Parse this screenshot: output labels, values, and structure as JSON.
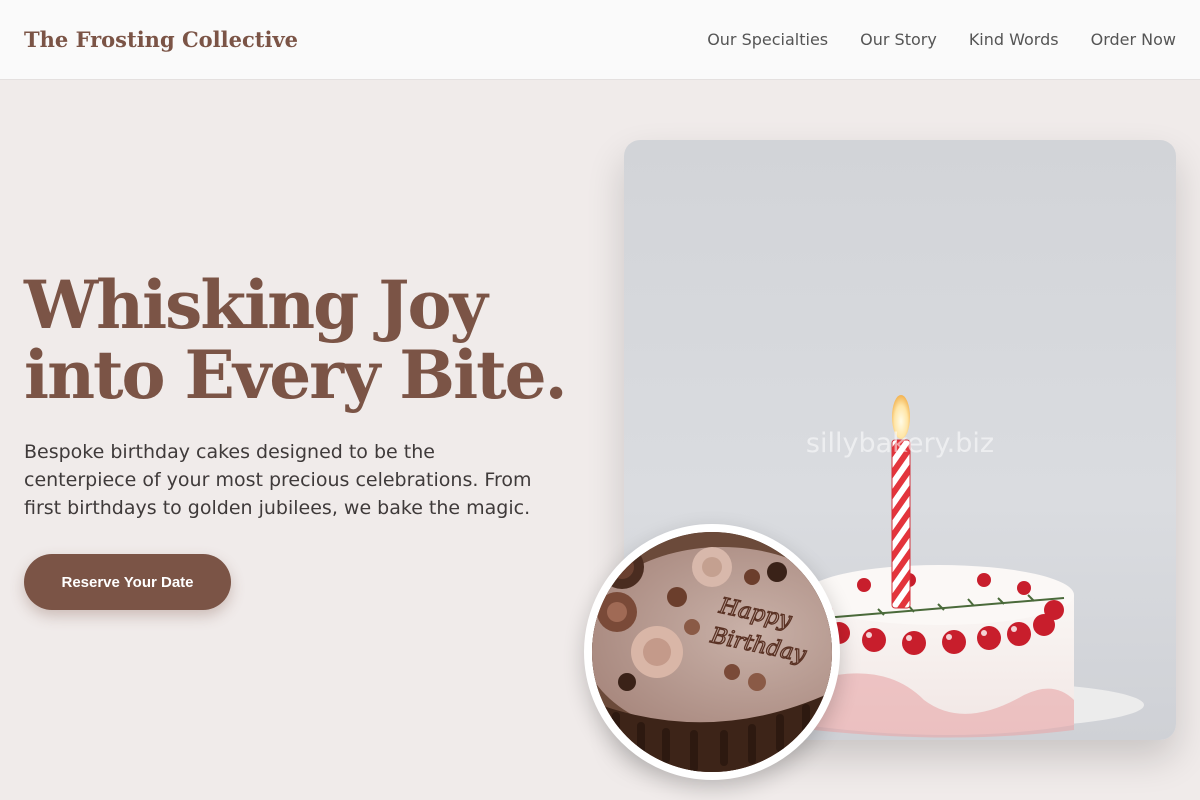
{
  "header": {
    "brand": "The Frosting Collective",
    "nav": [
      {
        "label": "Our Specialties"
      },
      {
        "label": "Our Story"
      },
      {
        "label": "Kind Words"
      },
      {
        "label": "Order Now"
      }
    ]
  },
  "hero": {
    "title_line1": "Whisking Joy",
    "title_line2": "into Every Bite.",
    "subtitle": "Bespoke birthday cakes designed to be the centerpiece of your most precious celebrations. From first birthdays to golden jubilees, we bake the magic.",
    "cta_label": "Reserve Your Date"
  },
  "images": {
    "main_watermark": "sillybakery.biz",
    "inset_cake_text_line1": "Happy",
    "inset_cake_text_line2": "Birthday"
  },
  "colors": {
    "brand": "#7b5446",
    "background": "#f0ebea",
    "header_bg": "#fafafa"
  }
}
